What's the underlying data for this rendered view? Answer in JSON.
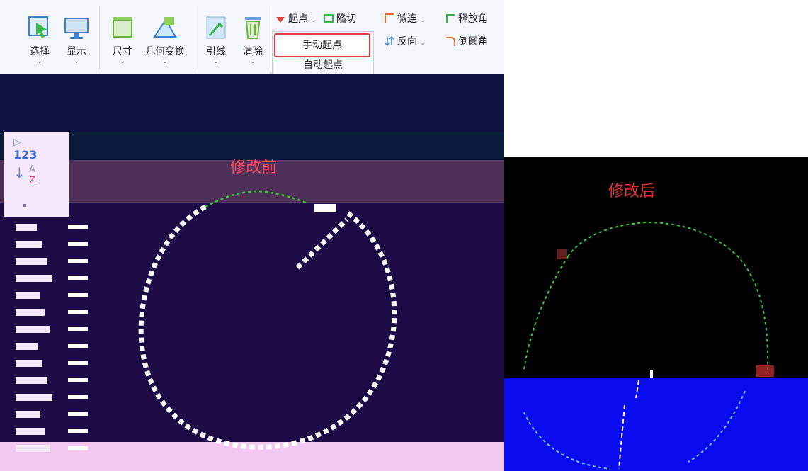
{
  "ribbon": {
    "buttons": [
      {
        "label": "选择",
        "icon": "select-icon"
      },
      {
        "label": "显示",
        "icon": "display-monitor-icon"
      },
      {
        "label": "尺寸",
        "icon": "dimension-icon"
      },
      {
        "label": "几何变换",
        "icon": "geometry-transform-icon"
      },
      {
        "label": "引线",
        "icon": "lead-line-icon"
      },
      {
        "label": "清除",
        "icon": "trash-icon"
      }
    ],
    "small_buttons": {
      "start_point": "起点",
      "cut": "陷切",
      "micro_connect": "微连",
      "release_angle": "释放角",
      "reverse": "反向",
      "chamfer": "倒圆角"
    },
    "dropdown": {
      "manual_start": "手动起点",
      "auto_start": "自动起点"
    }
  },
  "side_toolbar": {
    "number_label": "123",
    "sort_a": "A",
    "sort_z": "Z"
  },
  "labels": {
    "before": "修改前",
    "after": "修改后"
  },
  "colors": {
    "highlight_border": "#e0413a",
    "label_red": "#ff4a5c",
    "path_green": "#33cc33",
    "path_cyan": "#66ccff"
  }
}
